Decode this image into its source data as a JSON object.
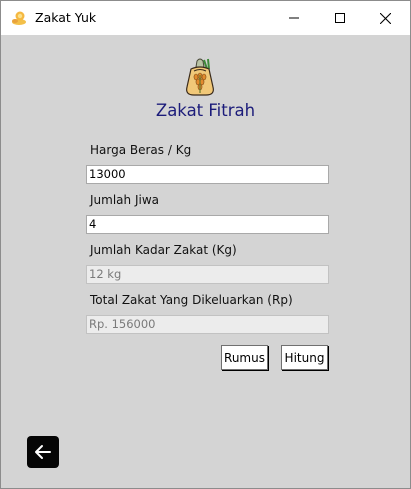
{
  "window": {
    "title": "Zakat Yuk"
  },
  "heading": "Zakat Fitrah",
  "form": {
    "harga_label": "Harga Beras / Kg",
    "harga_value": "13000",
    "jiwa_label": "Jumlah Jiwa",
    "jiwa_value": "4",
    "kadar_label": "Jumlah Kadar Zakat (Kg)",
    "kadar_value": "12 kg",
    "total_label": "Total Zakat Yang Dikeluarkan (Rp)",
    "total_value": "Rp. 156000"
  },
  "buttons": {
    "rumus": "Rumus",
    "hitung": "Hitung"
  },
  "icons": {
    "app": "zakat-app-icon",
    "logo": "rice-sack-icon",
    "back": "arrow-left-icon",
    "minimize": "minimize-icon",
    "maximize": "maximize-icon",
    "close": "close-icon"
  },
  "colors": {
    "background": "#d4d4d4",
    "heading": "#1c1c7a",
    "back_button": "#050505"
  }
}
